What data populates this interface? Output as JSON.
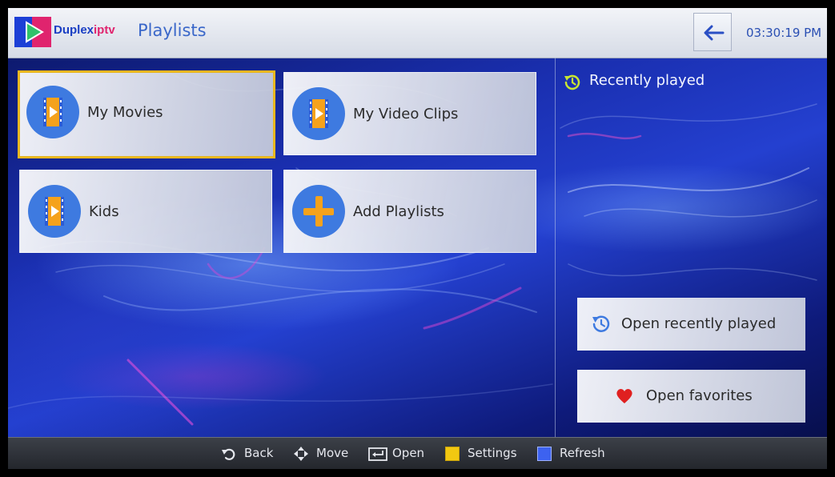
{
  "header": {
    "brand_part1": "Duplex",
    "brand_part2": "iptv",
    "title": "Playlists",
    "clock": "03:30:19 PM"
  },
  "playlists": [
    {
      "label": "My Movies",
      "icon": "video-file-icon",
      "selected": true
    },
    {
      "label": "My Video Clips",
      "icon": "video-file-icon",
      "selected": false
    },
    {
      "label": "Kids",
      "icon": "video-file-icon",
      "selected": false
    },
    {
      "label": "Add Playlists",
      "icon": "plus-icon",
      "selected": false
    }
  ],
  "recent": {
    "title": "Recently played",
    "open_recent_label": "Open recently played",
    "open_favorites_label": "Open favorites"
  },
  "footer": {
    "back": "Back",
    "move": "Move",
    "open": "Open",
    "settings": "Settings",
    "refresh": "Refresh"
  },
  "colors": {
    "accent_blue": "#3e7ae0",
    "selection_border": "#e8b720",
    "icon_orange": "#f5a21c",
    "favorite_red": "#e02020",
    "settings_key": "#f2c811",
    "refresh_key": "#3d62f0"
  }
}
